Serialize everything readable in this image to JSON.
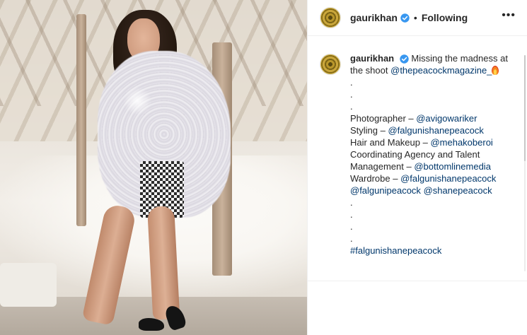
{
  "post": {
    "photo_alt": "gaurikhan post photo",
    "header": {
      "username": "gaurikhan",
      "separator": "•",
      "follow_state": "Following",
      "more_label": "•••"
    },
    "caption": {
      "username": "gaurikhan",
      "intro_text": "Missing the madness at the shoot",
      "mention_magazine": "@thepeacockmagazine_",
      "dots_top": [
        ".",
        ".",
        "."
      ],
      "photographer_label": "Photographer – ",
      "photographer": "@avigowariker",
      "styling_label": "Styling – ",
      "styling": "@falgunishanepeacock",
      "hair_label": "Hair and Makeup – ",
      "hair": "@mehakoberoi",
      "agency_label_1": "Coordinating Agency and Talent",
      "agency_label_2": "Management – ",
      "agency": "@bottomlinemedia",
      "wardrobe_label": "Wardrobe – ",
      "wardrobe": "@falgunishanepeacock",
      "wardrobe_2": "@falgunipeacock",
      "wardrobe_3": "@shanepeacock",
      "dots_bottom": [
        ".",
        ".",
        ".",
        "."
      ],
      "hashtag": "#falgunishanepeacock"
    }
  },
  "colors": {
    "text": "#262626",
    "link": "#00376b",
    "verified": "#3897f0",
    "border": "#efefef"
  },
  "icons": {
    "verified": "verified-badge-icon",
    "fire": "fire-emoji-icon",
    "more": "more-options-icon"
  }
}
